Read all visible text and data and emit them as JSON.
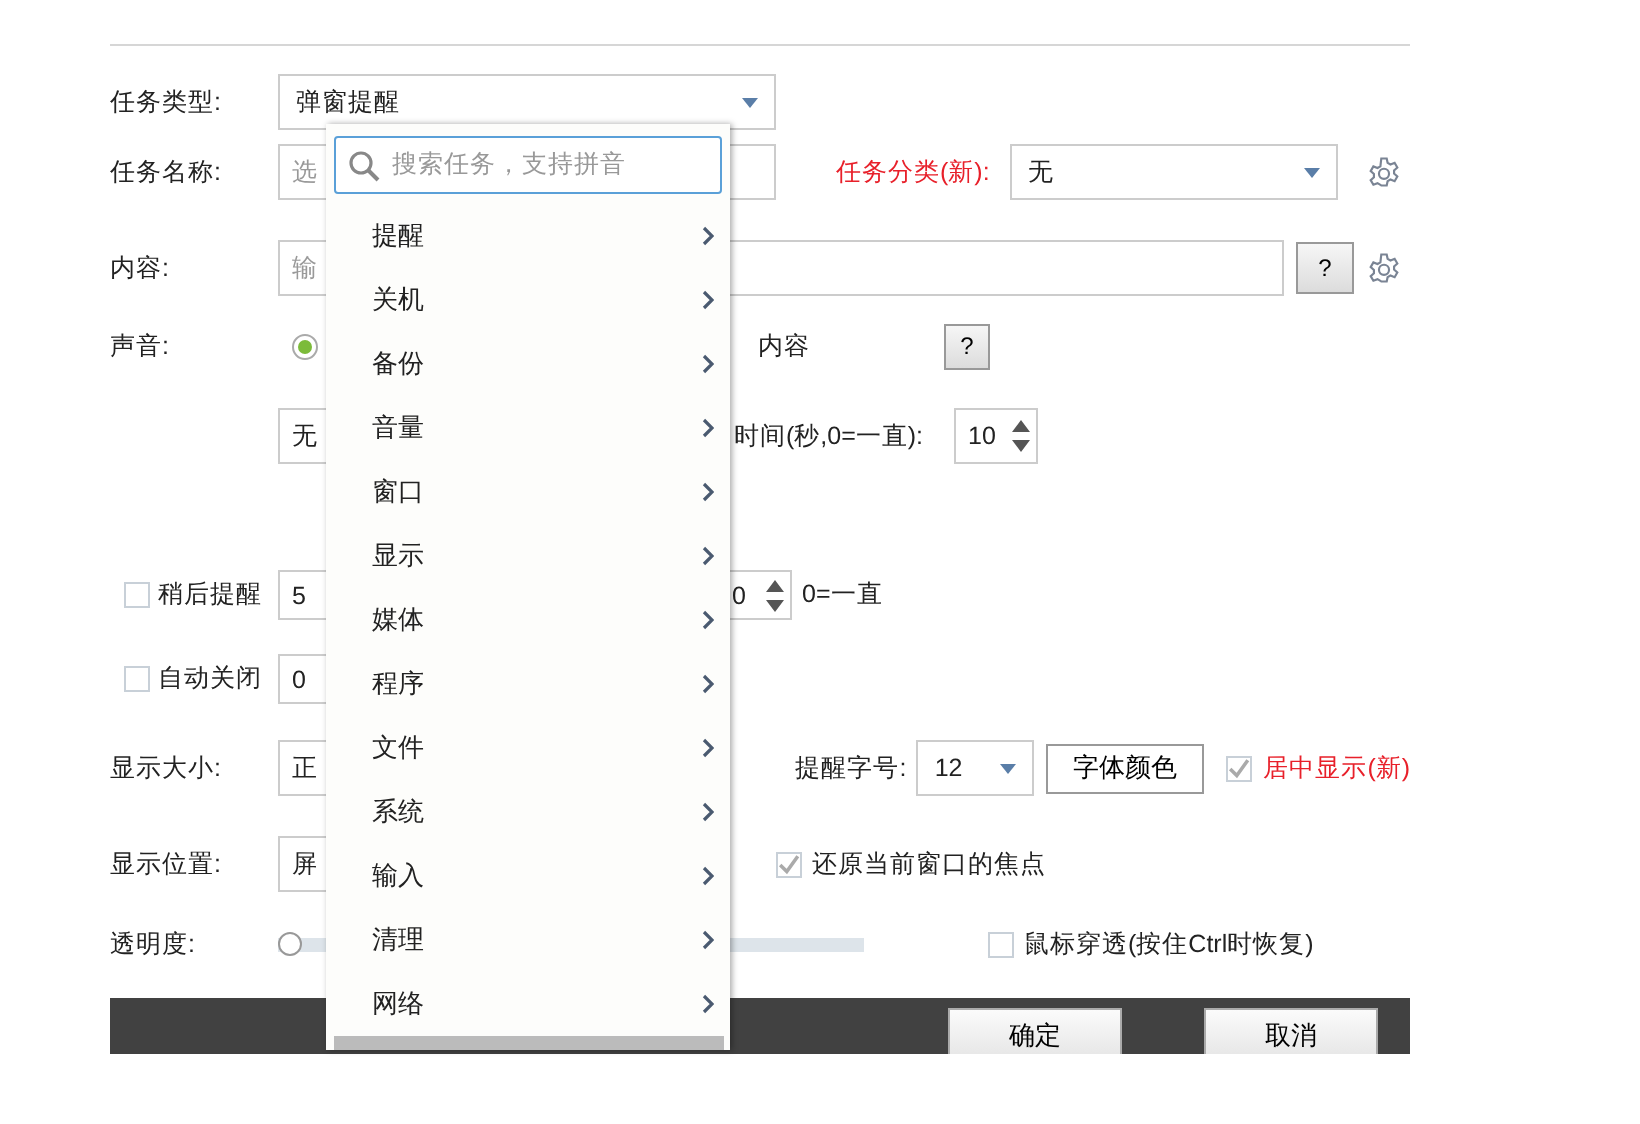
{
  "task_type": {
    "label": "任务类型:",
    "value": "弹窗提醒"
  },
  "task_name": {
    "label": "任务名称:",
    "placeholder": "选"
  },
  "task_category": {
    "label": "任务分类(新):",
    "value": "无"
  },
  "content": {
    "label": "内容:",
    "placeholder": "输",
    "help": "?"
  },
  "sound": {
    "label": "声音:",
    "radio": {
      "selected": true
    },
    "option_text": "内容",
    "help": "?",
    "select_value": "无",
    "duration_label": "时间(秒,0=一直):",
    "duration": "10"
  },
  "snooze": {
    "label": "稍后提醒",
    "checked": false,
    "value": "5",
    "repeat": "0",
    "repeat_note": "0=一直"
  },
  "auto_close": {
    "label": "自动关闭",
    "checked": false,
    "value": "0"
  },
  "display_size": {
    "label": "显示大小:",
    "value": "正"
  },
  "font_size": {
    "label": "提醒字号:",
    "value": "12"
  },
  "font_color_button": "字体颜色",
  "center_display": {
    "label": "居中显示(新)",
    "checked": true
  },
  "display_position": {
    "label": "显示位置:",
    "value": "屏"
  },
  "restore_focus": {
    "label": "还原当前窗口的焦点",
    "checked": true
  },
  "opacity": {
    "label": "透明度:",
    "level": 0
  },
  "mouse_through": {
    "label": "鼠标穿透(按住Ctrl时恢复)",
    "checked": false
  },
  "buttons": [
    "确定",
    "取消"
  ],
  "menu": {
    "search_placeholder": "搜索任务，支持拼音",
    "items": [
      "提醒",
      "关机",
      "备份",
      "音量",
      "窗口",
      "显示",
      "媒体",
      "程序",
      "文件",
      "系统",
      "输入",
      "清理",
      "网络"
    ]
  }
}
